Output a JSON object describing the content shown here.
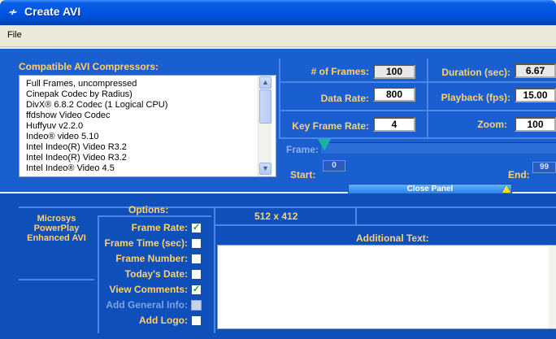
{
  "window": {
    "title": "Create AVI"
  },
  "menu": {
    "file": "File"
  },
  "compressors": {
    "header": "Compatible AVI Compressors:",
    "items": [
      "Full Frames, uncompressed",
      "Cinepak Codec by Radius)",
      "DivX® 6.8.2 Codec (1 Logical CPU)",
      "ffdshow Video Codec",
      "Huffyuv v2.2.0",
      "Indeo® video 5.10",
      "Intel Indeo(R) Video R3.2",
      "Intel Indeo(R) Video R3.2",
      "Intel Indeo® Video 4.5"
    ]
  },
  "settings": {
    "num_frames": {
      "label": "# of Frames:",
      "value": "100"
    },
    "data_rate": {
      "label": "Data Rate:",
      "value": "800"
    },
    "key_frame_rate": {
      "label": "Key Frame Rate:",
      "value": "4"
    },
    "duration": {
      "label": "Duration (sec):",
      "value": "6.67"
    },
    "playback": {
      "label": "Playback (fps):",
      "value": "15.00"
    },
    "zoom": {
      "label": "Zoom:",
      "value": "100"
    }
  },
  "frame_slider": {
    "label": "Frame:",
    "start_label": "Start:",
    "start_value": "0",
    "end_label": "End:",
    "end_value": "99"
  },
  "close_panel": "Close Panel",
  "brand": "Microsys PowerPlay Enhanced AVI",
  "options": {
    "header": "Options:",
    "items": [
      {
        "label": "Frame Rate:",
        "checked": true,
        "enabled": true
      },
      {
        "label": "Frame Time (sec):",
        "checked": false,
        "enabled": true
      },
      {
        "label": "Frame Number:",
        "checked": false,
        "enabled": true
      },
      {
        "label": "Today's Date:",
        "checked": false,
        "enabled": true
      },
      {
        "label": "View Comments:",
        "checked": true,
        "enabled": true
      },
      {
        "label": "Add General Info:",
        "checked": false,
        "enabled": false
      },
      {
        "label": "Add Logo:",
        "checked": false,
        "enabled": true
      }
    ]
  },
  "dimensions": "512 x 412",
  "additional_text": {
    "label": "Additional Text:",
    "value": ""
  },
  "colors": {
    "title_bar": "#0054e3",
    "panel": "#1a5fd0",
    "label": "#ffd36a",
    "check": "#21a121"
  }
}
